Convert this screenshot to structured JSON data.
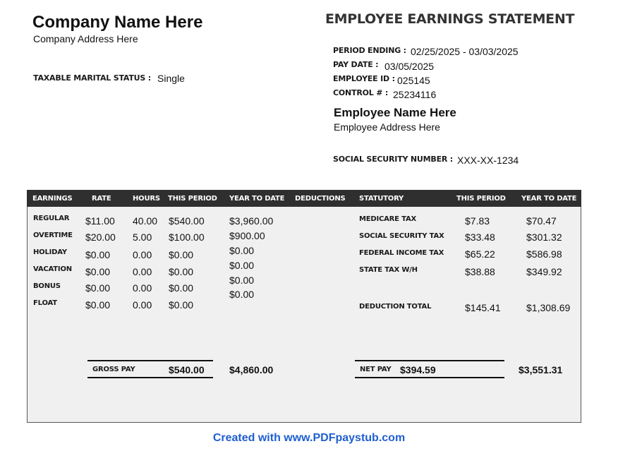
{
  "company": {
    "name": "Company Name Here",
    "address": "Company Address Here",
    "marital_status_label": "TAXABLE MARITAL STATUS :",
    "marital_status_value": "Single"
  },
  "statement": {
    "title": "EMPLOYEE EARNINGS STATEMENT",
    "period_ending_label": "PERIOD ENDING :",
    "period_ending_value": "02/25/2025 - 03/03/2025",
    "pay_date_label": "PAY DATE :",
    "pay_date_value": "03/05/2025",
    "employee_id_label": "EMPLOYEE ID :",
    "employee_id_value": "025145",
    "control_label": "CONTROL # :",
    "control_value": "25234116"
  },
  "employee": {
    "name": "Employee Name Here",
    "address": "Employee Address Here",
    "ssn_label": "SOCIAL SECURITY NUMBER :",
    "ssn_value": "XXX-XX-1234"
  },
  "table": {
    "headers": [
      "EARNINGS",
      "RATE",
      "HOURS",
      "THIS PERIOD",
      "YEAR TO DATE",
      "DEDUCTIONS",
      "STATUTORY",
      "THIS PERIOD",
      "YEAR TO DATE"
    ],
    "earnings": [
      {
        "name": "REGULAR",
        "rate": "$11.00",
        "hours": "40.00",
        "period": "$540.00"
      },
      {
        "name": "OVERTIME",
        "rate": "$20.00",
        "hours": "5.00",
        "period": "$100.00"
      },
      {
        "name": "HOLIDAY",
        "rate": "$0.00",
        "hours": "0.00",
        "period": "$0.00"
      },
      {
        "name": "VACATION",
        "rate": "$0.00",
        "hours": "0.00",
        "period": "$0.00"
      },
      {
        "name": "BONUS",
        "rate": "$0.00",
        "hours": "0.00",
        "period": "$0.00"
      },
      {
        "name": "FLOAT",
        "rate": "$0.00",
        "hours": "0.00",
        "period": "$0.00"
      }
    ],
    "ytd": [
      "$3,960.00",
      "$900.00",
      "$0.00",
      "$0.00",
      "$0.00",
      "$0.00"
    ],
    "statutory": [
      {
        "name": "MEDICARE TAX",
        "period": "$7.83",
        "ytd": "$70.47"
      },
      {
        "name": "SOCIAL SECURITY TAX",
        "period": "$33.48",
        "ytd": "$301.32"
      },
      {
        "name": "FEDERAL INCOME TAX",
        "period": "$65.22",
        "ytd": "$586.98"
      },
      {
        "name": "STATE TAX W/H",
        "period": "$38.88",
        "ytd": "$349.92"
      }
    ],
    "deduction_total": {
      "label": "DEDUCTION TOTAL",
      "period": "$145.41",
      "ytd": "$1,308.69"
    },
    "gross_pay": {
      "label": "GROSS PAY",
      "period": "$540.00",
      "ytd": "$4,860.00"
    },
    "net_pay": {
      "label": "NET PAY",
      "period": "$394.59",
      "ytd": "$3,551.31"
    }
  },
  "footer": {
    "credit": "Created with www.PDFpaystub.com"
  }
}
